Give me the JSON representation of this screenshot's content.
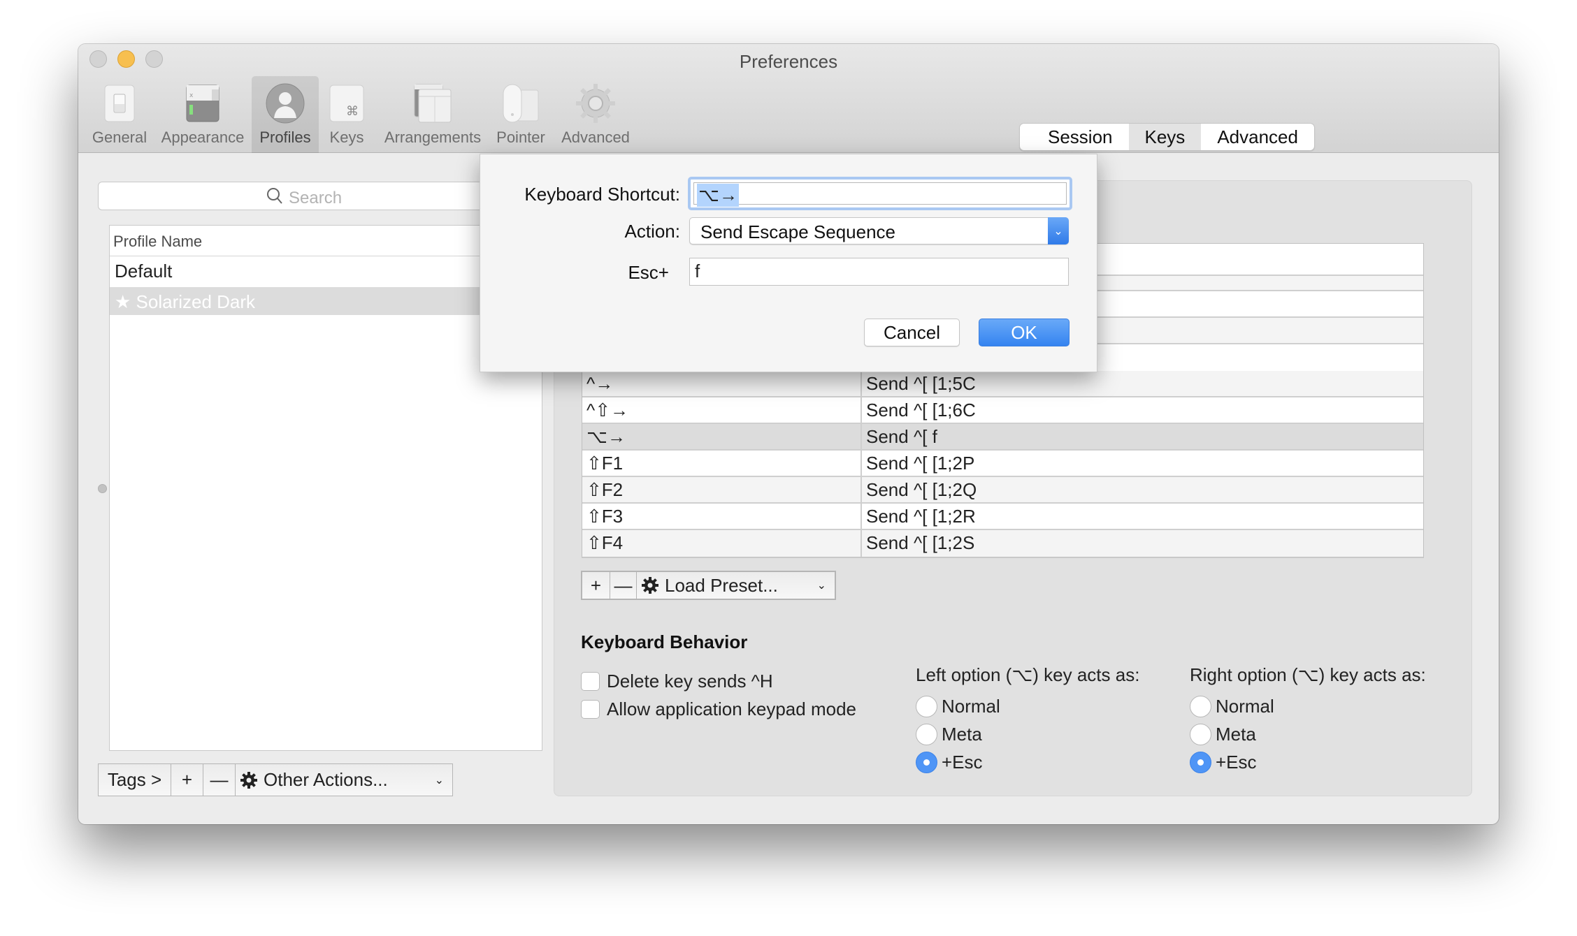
{
  "window": {
    "title": "Preferences",
    "traffic_lights": [
      "close",
      "minimize",
      "zoom"
    ]
  },
  "toolbar": {
    "items": [
      {
        "label": "General",
        "icon": "switch-icon",
        "selected": false
      },
      {
        "label": "Appearance",
        "icon": "appearance-icon",
        "selected": false
      },
      {
        "label": "Profiles",
        "icon": "person-icon",
        "selected": true
      },
      {
        "label": "Keys",
        "icon": "command-key-icon",
        "selected": false
      },
      {
        "label": "Arrangements",
        "icon": "windows-icon",
        "selected": false
      },
      {
        "label": "Pointer",
        "icon": "mouse-icon",
        "selected": false
      },
      {
        "label": "Advanced",
        "icon": "gear-icon",
        "selected": false
      }
    ]
  },
  "profiles": {
    "search_placeholder": "Search",
    "column_header": "Profile Name",
    "rows": [
      {
        "name": "Default",
        "selected": false
      },
      {
        "name": "★ Solarized Dark",
        "selected": true
      }
    ],
    "bottom_bar": {
      "tags": "Tags >",
      "add": "+",
      "remove": "—",
      "other_actions": "Other Actions...",
      "chevron": "⌄"
    }
  },
  "tabs": [
    {
      "label": "Session",
      "active": false
    },
    {
      "label": "Keys",
      "active": true
    },
    {
      "label": "Advanced",
      "active": false
    }
  ],
  "key_mappings": {
    "rows": [
      {
        "key": "",
        "action": ""
      },
      {
        "key": "",
        "action": ""
      },
      {
        "key": "",
        "action": ""
      },
      {
        "key": "",
        "action": ""
      },
      {
        "key": "^→",
        "action": "Send ^[ [1;5C"
      },
      {
        "key": "^⇧→",
        "action": "Send ^[ [1;6C"
      },
      {
        "key": "⌥→",
        "action": "Send ^[ f",
        "selected": true
      },
      {
        "key": "⇧F1",
        "action": "Send ^[ [1;2P"
      },
      {
        "key": "⇧F2",
        "action": "Send ^[ [1;2Q"
      },
      {
        "key": "⇧F3",
        "action": "Send ^[ [1;2R"
      },
      {
        "key": "⇧F4",
        "action": "Send ^[ [1;2S"
      }
    ],
    "add": "+",
    "remove": "—",
    "load_preset": "Load Preset..."
  },
  "keyboard_behavior": {
    "heading": "Keyboard Behavior",
    "checkboxes": [
      {
        "label": "Delete key sends ^H",
        "checked": false
      },
      {
        "label": "Allow application keypad mode",
        "checked": false
      }
    ],
    "left_option": {
      "title": "Left option (⌥) key acts as:",
      "options": [
        "Normal",
        "Meta",
        "+Esc"
      ],
      "selected": "+Esc"
    },
    "right_option": {
      "title": "Right option (⌥) key acts as:",
      "options": [
        "Normal",
        "Meta",
        "+Esc"
      ],
      "selected": "+Esc"
    }
  },
  "dialog": {
    "shortcut_label": "Keyboard Shortcut:",
    "shortcut_value": "⌥→",
    "action_label": "Action:",
    "action_value": "Send Escape Sequence",
    "esc_label": "Esc+",
    "esc_value": "f",
    "cancel": "Cancel",
    "ok": "OK"
  },
  "colors": {
    "accent": "#3584f0",
    "selection": "#b3d4fd",
    "minimize": "#f7bf4f"
  }
}
